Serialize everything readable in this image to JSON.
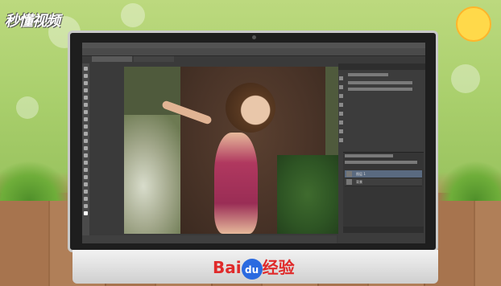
{
  "watermark_logo": "秒懂视频",
  "brand": {
    "part1": "Bai",
    "part2": "du",
    "part3": "经验"
  },
  "ps": {
    "layers": [
      {
        "name": "图层 1"
      },
      {
        "name": "背景"
      }
    ]
  },
  "colors": {
    "accent": "#e02a2a",
    "brand_blue": "#2a6ae0",
    "ps_bg": "#3a3a3a"
  }
}
